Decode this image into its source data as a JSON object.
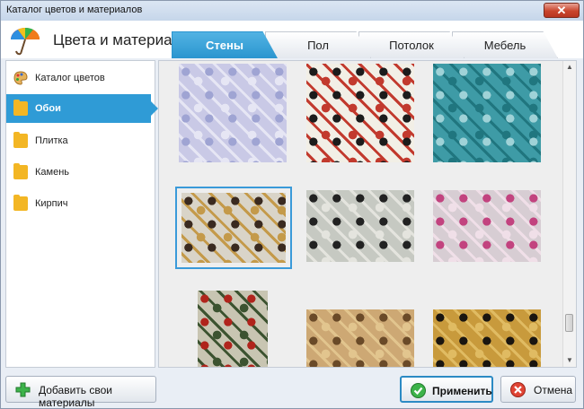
{
  "window": {
    "title": "Каталог цветов и материалов",
    "close_glyph": "✕"
  },
  "header": {
    "app_title": "Цвета и материалы",
    "logo_icon": "umbrella-palette-icon"
  },
  "tabs": [
    {
      "label": "Стены",
      "active": true
    },
    {
      "label": "Пол",
      "active": false
    },
    {
      "label": "Потолок",
      "active": false
    },
    {
      "label": "Мебель",
      "active": false
    }
  ],
  "sidebar": {
    "items": [
      {
        "label": "Каталог цветов",
        "icon": "palette-icon",
        "active": false
      },
      {
        "label": "Обои",
        "icon": "folder-icon",
        "active": true
      },
      {
        "label": "Плитка",
        "icon": "folder-icon",
        "active": false
      },
      {
        "label": "Камень",
        "icon": "folder-icon",
        "active": false
      },
      {
        "label": "Кирпич",
        "icon": "folder-icon",
        "active": false
      }
    ]
  },
  "gallery": {
    "items": [
      {
        "name": "lilac-damask",
        "colors": [
          "#c9c9e6",
          "#9fa4d3",
          "#e6e6f4"
        ],
        "selected": false
      },
      {
        "name": "black-white-red-abstract",
        "colors": [
          "#f2efe6",
          "#1c1c1c",
          "#c23a2e"
        ],
        "selected": false
      },
      {
        "name": "teal-circles",
        "colors": [
          "#3e9ba6",
          "#9fd2d7",
          "#20767f"
        ],
        "selected": false
      },
      {
        "name": "brown-gold-rings",
        "colors": [
          "#d9d4c8",
          "#3a2a20",
          "#c49a4a"
        ],
        "selected": true
      },
      {
        "name": "grey-branches",
        "colors": [
          "#c6c9c2",
          "#222222",
          "#e4e4de"
        ],
        "selected": false
      },
      {
        "name": "pink-roses",
        "colors": [
          "#d7cdd3",
          "#c2437f",
          "#f0dfe8"
        ],
        "selected": false
      },
      {
        "name": "red-poppies",
        "colors": [
          "#c8c5b2",
          "#b0241c",
          "#3c5330"
        ],
        "selected": false
      },
      {
        "name": "golden-leaves",
        "colors": [
          "#cda874",
          "#6a4a28",
          "#e2c58e"
        ],
        "selected": false
      },
      {
        "name": "black-gold-swirls",
        "colors": [
          "#c89a3c",
          "#1a1510",
          "#e0bb62"
        ],
        "selected": false
      }
    ]
  },
  "buttons": {
    "add": {
      "label": "Добавить свои материалы",
      "icon": "green-plus-icon"
    },
    "apply": {
      "label": "Применить",
      "icon": "green-check-icon"
    },
    "cancel": {
      "label": "Отмена",
      "icon": "red-cancel-icon"
    }
  },
  "colors": {
    "accent": "#2f9bd6",
    "tab_active": "#3aa3db"
  }
}
